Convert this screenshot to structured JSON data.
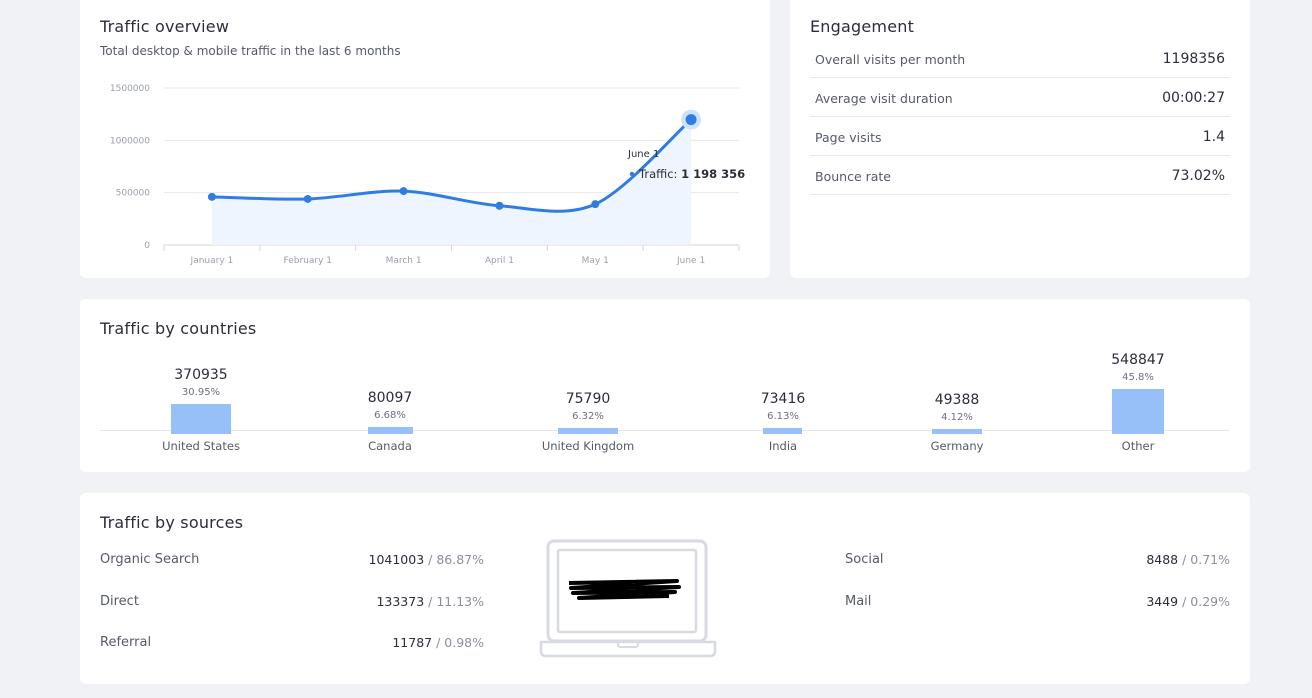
{
  "traffic_overview": {
    "title": "Traffic overview",
    "subtitle": "Total desktop & mobile traffic in the last 6 months",
    "tooltip": {
      "date": "June 1",
      "label": "Traffic:",
      "value": "1 198 356"
    },
    "chart_data": {
      "type": "area",
      "categories": [
        "January 1",
        "February 1",
        "March 1",
        "April 1",
        "May 1",
        "June 1"
      ],
      "values": [
        460000,
        440000,
        515000,
        375000,
        390000,
        1198356
      ],
      "y_ticks": [
        "1500000",
        "1000000",
        "500000",
        "0"
      ],
      "ylim": [
        0,
        1500000
      ],
      "grid": true,
      "color": "#2f7de1"
    }
  },
  "engagement": {
    "title": "Engagement",
    "rows": [
      {
        "label": "Overall visits per month",
        "value": "1198356"
      },
      {
        "label": "Average visit duration",
        "value": "00:00:27"
      },
      {
        "label": "Page visits",
        "value": "1.4"
      },
      {
        "label": "Bounce rate",
        "value": "73.02%"
      }
    ]
  },
  "countries": {
    "title": "Traffic by countries",
    "bar_color": "#96c0f7",
    "chart_data": {
      "type": "bar",
      "categories": [
        "United States",
        "Canada",
        "United Kingdom",
        "India",
        "Germany",
        "Other"
      ],
      "values": [
        370935,
        80097,
        75790,
        73416,
        49388,
        548847
      ],
      "percents": [
        "30.95%",
        "6.68%",
        "6.32%",
        "6.13%",
        "4.12%",
        "45.8%"
      ]
    },
    "items": [
      {
        "name": "United States",
        "value": "370935",
        "pct": "30.95%"
      },
      {
        "name": "Canada",
        "value": "80097",
        "pct": "6.68%"
      },
      {
        "name": "United Kingdom",
        "value": "75790",
        "pct": "6.32%"
      },
      {
        "name": "India",
        "value": "73416",
        "pct": "6.13%"
      },
      {
        "name": "Germany",
        "value": "49388",
        "pct": "4.12%"
      },
      {
        "name": "Other",
        "value": "548847",
        "pct": "45.8%"
      }
    ]
  },
  "sources": {
    "title": "Traffic by sources",
    "left": [
      {
        "label": "Organic Search",
        "value": "1041003",
        "pct": " / 86.87%"
      },
      {
        "label": "Direct",
        "value": "133373",
        "pct": " / 11.13%"
      },
      {
        "label": "Referral",
        "value": "11787",
        "pct": " / 0.98%"
      }
    ],
    "right": [
      {
        "label": "Social",
        "value": "8488",
        "pct": " / 0.71%"
      },
      {
        "label": "Mail",
        "value": "3449",
        "pct": " / 0.29%"
      }
    ],
    "illustration_icon": "laptop-icon"
  }
}
